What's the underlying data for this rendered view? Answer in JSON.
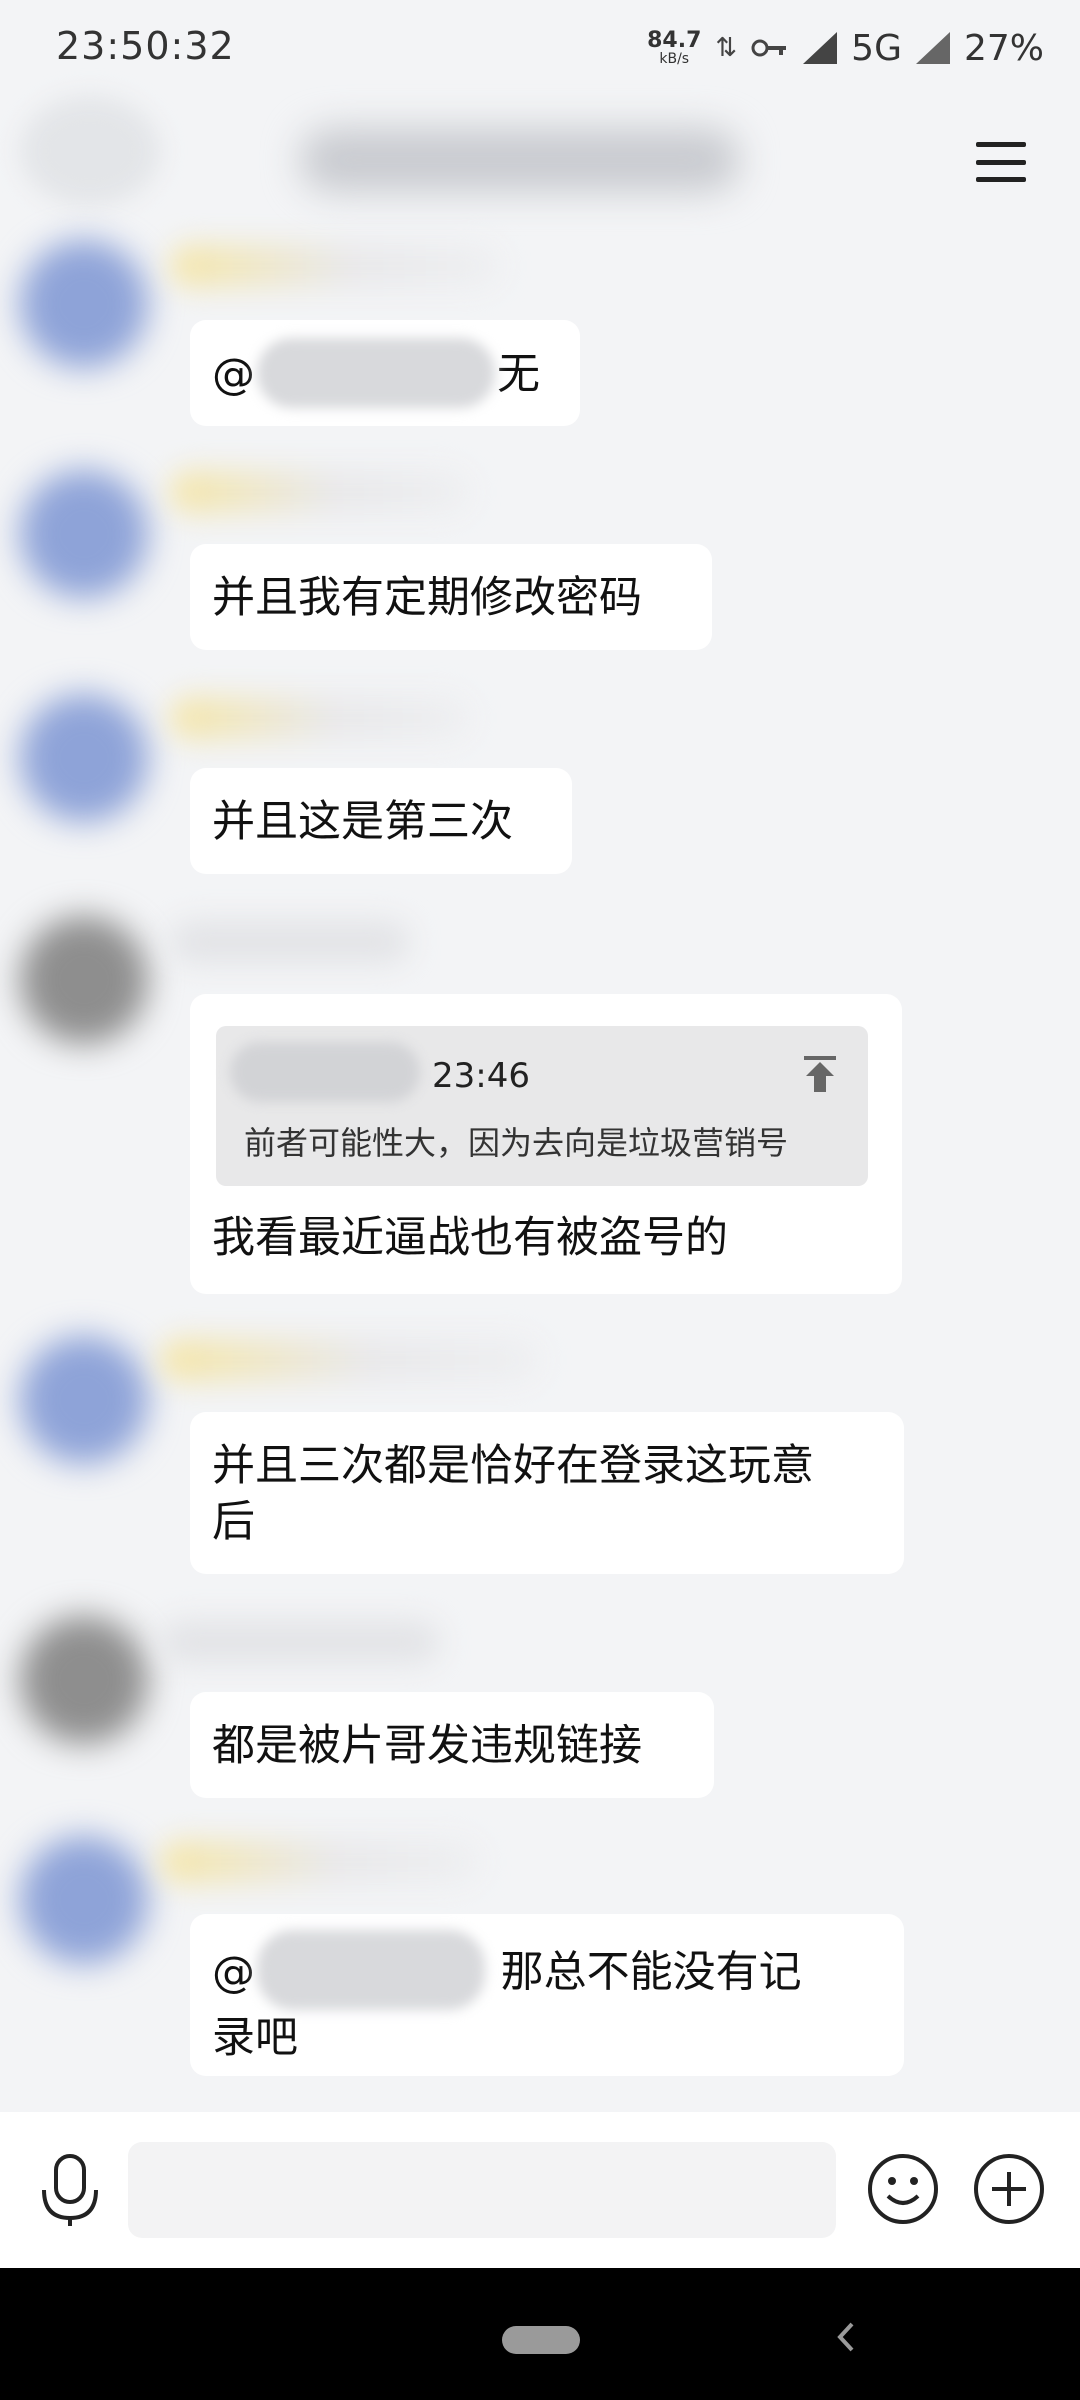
{
  "status_bar": {
    "time": "23:50:32",
    "net_speed": "84.7",
    "net_unit": "kB/s",
    "network": "5G",
    "battery": "27%"
  },
  "messages": [
    {
      "sender_type": "blue",
      "prefix": "@",
      "suffix": "无"
    },
    {
      "sender_type": "blue",
      "text": "并且我有定期修改密码"
    },
    {
      "sender_type": "blue",
      "text": "并且这是第三次"
    },
    {
      "sender_type": "grey",
      "quote_time": "23:46",
      "quote_text": "前者可能性大，因为去向是垃圾营销号",
      "text": "我看最近逼战也有被盗号的"
    },
    {
      "sender_type": "blue",
      "line1": "并且三次都是恰好在登录这玩意",
      "line2": "后"
    },
    {
      "sender_type": "grey",
      "text": "都是被片哥发违规链接"
    },
    {
      "sender_type": "blue",
      "prefix": "@",
      "line1_rest": " 那总不能没有记",
      "line2": "录吧"
    }
  ],
  "icons": {
    "menu": "menu-icon",
    "voice": "microphone-icon",
    "emoji": "emoji-icon",
    "more": "plus-icon",
    "pin": "pin-top-icon",
    "home": "home-pill",
    "back": "back-icon"
  },
  "colors": {
    "chat_background": "#f3f4f6",
    "bubble": "#ffffff",
    "quote_background": "#e8e8e9",
    "nav_bar": "#000000"
  }
}
